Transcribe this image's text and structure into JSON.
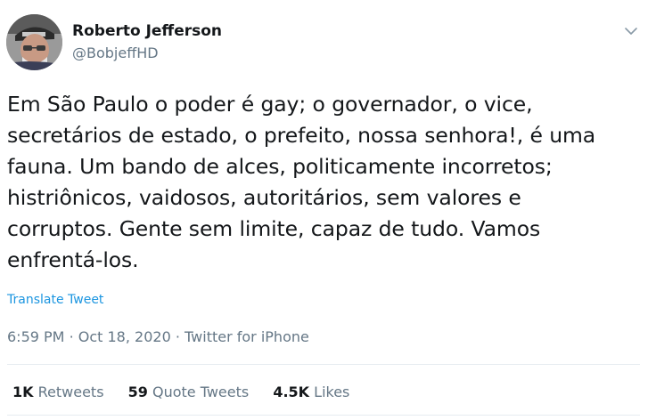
{
  "author": {
    "display_name": "Roberto Jefferson",
    "handle": "@BobjeffHD",
    "avatar_icon": "user-avatar"
  },
  "tweet": {
    "text": "Em São Paulo o poder é gay; o governador, o vice,\nsecretários de estado, o prefeito, nossa senhora!, é uma\nfauna. Um bando de alces, politicamente incorretos;\nhistriônicos, vaidosos, autoritários, sem valores e\ncorruptos. Gente sem limite, capaz de tudo. Vamos\nenfrentá-los.",
    "translate_label": "Translate Tweet",
    "time": "6:59 PM",
    "separator": "·",
    "date": "Oct 18, 2020",
    "source": "Twitter for iPhone"
  },
  "stats": {
    "retweets_count": "1K",
    "retweets_label": "Retweets",
    "quote_count": "59",
    "quote_label": "Quote Tweets",
    "likes_count": "4.5K",
    "likes_label": "Likes"
  },
  "colors": {
    "text": "#14171a",
    "secondary": "#657786",
    "link": "#1b95e0",
    "divider": "#e6ecf0"
  }
}
